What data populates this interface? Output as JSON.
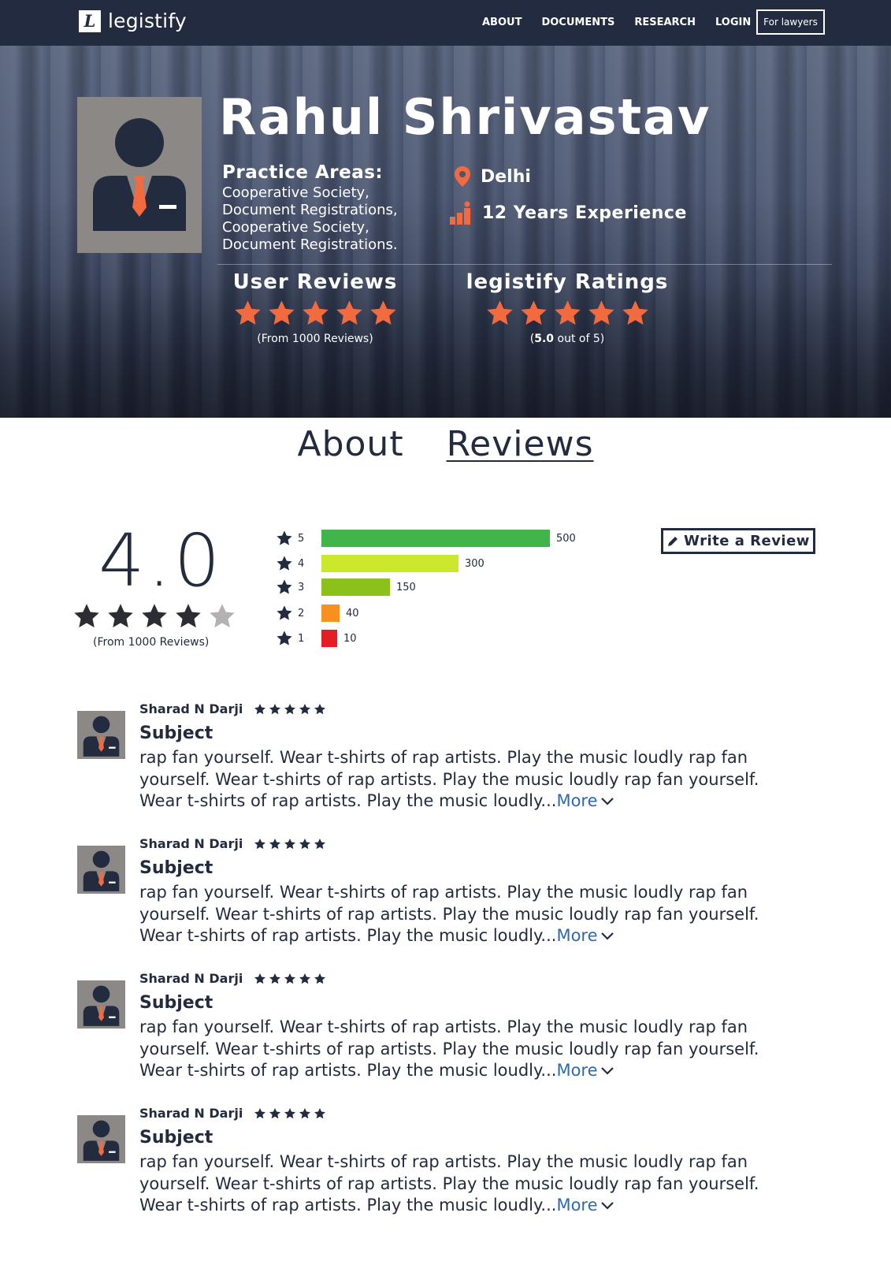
{
  "nav": {
    "logo_letter": "L",
    "logo_text": "legistify",
    "links": [
      "ABOUT",
      "DOCUMENTS",
      "RESEARCH",
      "LOGIN"
    ],
    "cta": "For lawyers"
  },
  "profile": {
    "name": "Rahul Shrivastav",
    "practice_title": "Practice Areas:",
    "practice_areas": [
      "Cooperative Society,",
      "Document Registrations,",
      "Cooperative Society,",
      "Document Registrations."
    ],
    "location": "Delhi",
    "experience": "12 Years Experience",
    "user_reviews_title": "User Reviews",
    "user_reviews_sub": "(From 1000 Reviews)",
    "user_rating_stars": 5,
    "legistify_title": "legistify Ratings",
    "legistify_score": "5.0",
    "legistify_sub_rest": " out of 5)",
    "legistify_sub_open": "(",
    "legistify_rating_stars": 5
  },
  "tabs": [
    "About",
    "Reviews"
  ],
  "active_tab": "Reviews",
  "summary": {
    "average": "4.0",
    "average_stars": 4,
    "total_text": "(From 1000 Reviews)",
    "write_review": "Write a Review"
  },
  "chart_data": {
    "type": "bar",
    "categories": [
      "5",
      "4",
      "3",
      "2",
      "1"
    ],
    "values": [
      500,
      300,
      150,
      40,
      10
    ],
    "colors": [
      "#3fb54a",
      "#cbe82c",
      "#8bc11a",
      "#f7901e",
      "#e31e24"
    ],
    "title": "",
    "xlabel": "",
    "ylabel": ""
  },
  "reviews": [
    {
      "author": "Sharad N Darji",
      "stars": 5,
      "subject": "Subject",
      "body": "rap fan yourself. Wear t-shirts of rap artists. Play the music loudly rap fan yourself. Wear t-shirts of rap artists. Play the music loudly rap fan yourself. Wear t-shirts of rap artists. Play the music loudly...",
      "more": "More"
    },
    {
      "author": "Sharad N Darji",
      "stars": 5,
      "subject": "Subject",
      "body": "rap fan yourself. Wear t-shirts of rap artists. Play the music loudly rap fan yourself. Wear t-shirts of rap artists. Play the music loudly rap fan yourself. Wear t-shirts of rap artists. Play the music loudly...",
      "more": "More"
    },
    {
      "author": "Sharad N Darji",
      "stars": 5,
      "subject": "Subject",
      "body": "rap fan yourself. Wear t-shirts of rap artists. Play the music loudly rap fan yourself. Wear t-shirts of rap artists. Play the music loudly rap fan yourself. Wear t-shirts of rap artists. Play the music loudly...",
      "more": "More"
    },
    {
      "author": "Sharad N Darji",
      "stars": 5,
      "subject": "Subject",
      "body": "rap fan yourself. Wear t-shirts of rap artists. Play the music loudly rap fan yourself. Wear t-shirts of rap artists. Play the music loudly rap fan yourself. Wear t-shirts of rap artists. Play the music loudly...",
      "more": "More"
    }
  ],
  "colors": {
    "nav_bg": "#222b40",
    "text_dark": "#232b3f",
    "accent_orange": "#f26a3d",
    "link_blue": "#2f6ab0",
    "avatar_bg": "#8c8886"
  }
}
